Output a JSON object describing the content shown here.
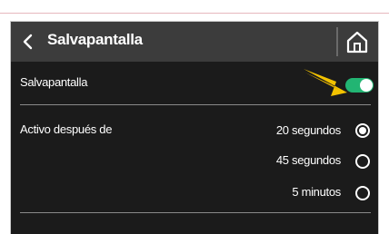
{
  "header": {
    "title": "Salvapantalla"
  },
  "screensaver": {
    "label": "Salvapantalla",
    "enabled": true
  },
  "active_after": {
    "label": "Activo después de",
    "options": [
      {
        "label": "20 segundos",
        "selected": true
      },
      {
        "label": "45 segundos",
        "selected": false
      },
      {
        "label": "5 minutos",
        "selected": false
      }
    ]
  },
  "colors": {
    "toggle_on": "#22b573",
    "pointer_arrow": "#f2c200",
    "header_bg": "#3c3c3c",
    "screen_bg": "#1b1b1b"
  }
}
